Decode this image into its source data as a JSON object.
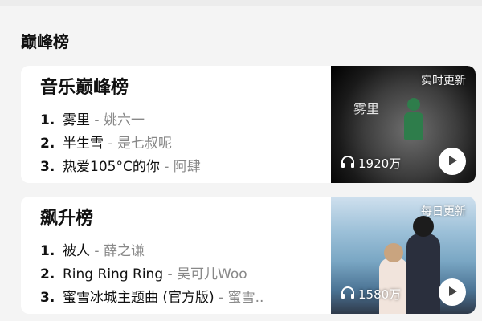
{
  "section": {
    "title": "巅峰榜"
  },
  "charts": [
    {
      "title": "音乐巅峰榜",
      "cover_label": "实时更新",
      "plays": "1920万",
      "cover_text": "雾里",
      "tracks": [
        {
          "rank": "1.",
          "song": "雾里",
          "artist": "姚六一"
        },
        {
          "rank": "2.",
          "song": "半生雪",
          "artist": "是七叔呢"
        },
        {
          "rank": "3.",
          "song": "热爱105°C的你",
          "artist": "阿肆"
        }
      ]
    },
    {
      "title": "飙升榜",
      "cover_label": "每日更新",
      "plays": "1580万",
      "tracks": [
        {
          "rank": "1.",
          "song": "被人",
          "artist": "薛之谦"
        },
        {
          "rank": "2.",
          "song": "Ring Ring Ring",
          "artist": "吴可儿Woo"
        },
        {
          "rank": "3.",
          "song": "蜜雪冰城主题曲 (官方版)",
          "artist": "蜜雪.."
        }
      ]
    }
  ],
  "separator": " - ",
  "icons": {
    "plays": "headphones-icon",
    "play": "play-icon"
  }
}
